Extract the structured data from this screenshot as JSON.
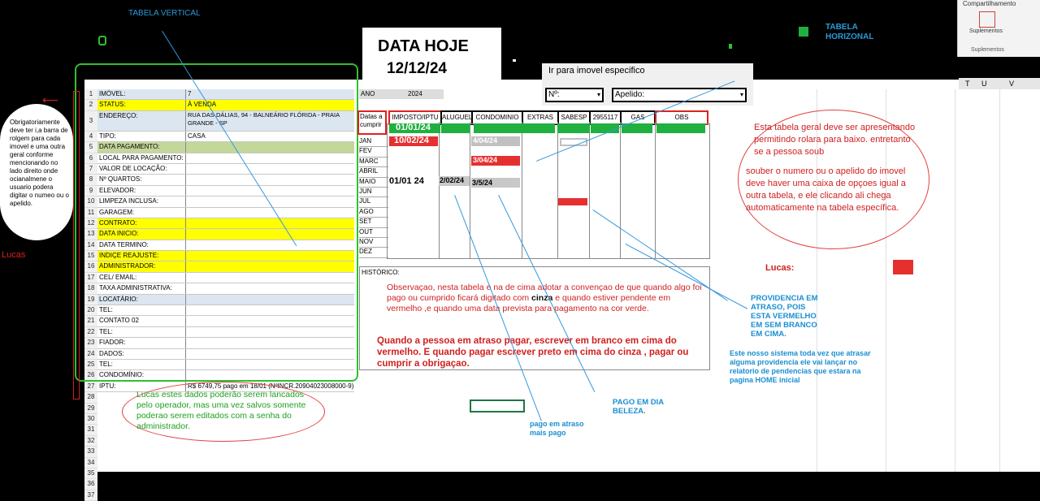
{
  "labels": {
    "tabela_vertical": "TABELA VERTICAL",
    "tabela_horizontal_1": "TABELA",
    "tabela_horizontal_2": "HORIZONAL",
    "data_hoje": "DATA HOJE",
    "data_hoje_value": "12/12/24",
    "ir_para": "Ir para imovel especifico",
    "no_field": "Nº:",
    "apelido_field": "Apelido:",
    "ano_label": "ANO",
    "ano_value": "2024",
    "datas_a_cumprir": "Datas a cumprir",
    "historico": "HISTÓRICO:",
    "lucas_left": "Lucas",
    "lucas_right": "Lucas:"
  },
  "ribbon": {
    "title": "Compartilhamento",
    "suplementos_button": "Suplementos",
    "suplementos_group": "Suplementos",
    "columns": [
      "T",
      "U",
      "V"
    ]
  },
  "vertical_table": [
    {
      "n": "1",
      "label": "IMÓVEL:",
      "value": "7",
      "style": "blue"
    },
    {
      "n": "2",
      "label": "STATUS:",
      "value": "À VENDA",
      "style": "yellow"
    },
    {
      "n": "3",
      "label": "ENDEREÇO:",
      "value": "RUA DAS DÁLIAS, 94 - BALNEÁRIO FLÓRIDA - PRAIA GRANDE - SP",
      "style": "blue",
      "tall": true
    },
    {
      "n": "4",
      "label": "TIPO:",
      "value": "CASA",
      "style": ""
    },
    {
      "n": "5",
      "label": "DATA PAGAMENTO:",
      "value": "",
      "style": "green"
    },
    {
      "n": "6",
      "label": "LOCAL PARA PAGAMENTO:",
      "value": "",
      "style": ""
    },
    {
      "n": "7",
      "label": "VALOR DE LOCAÇÃO:",
      "value": "",
      "style": ""
    },
    {
      "n": "8",
      "label": "Nº QUARTOS:",
      "value": "",
      "style": ""
    },
    {
      "n": "9",
      "label": "ELEVADOR:",
      "value": "",
      "style": ""
    },
    {
      "n": "10",
      "label": "LIMPEZA INCLUSA:",
      "value": "",
      "style": ""
    },
    {
      "n": "11",
      "label": "GARAGEM:",
      "value": "",
      "style": ""
    },
    {
      "n": "12",
      "label": "CONTRATO:",
      "value": "",
      "style": "yellow"
    },
    {
      "n": "13",
      "label": "DATA INICIO:",
      "value": "",
      "style": "yellow"
    },
    {
      "n": "14",
      "label": "DATA TERMINO:",
      "value": "",
      "style": ""
    },
    {
      "n": "15",
      "label": "INDIÇE REAJUSTE:",
      "value": "",
      "style": "yellow"
    },
    {
      "n": "16",
      "label": "ADMINISTRADOR:",
      "value": "",
      "style": "yellow"
    },
    {
      "n": "17",
      "label": "CEL/ EMAIL:",
      "value": "",
      "style": ""
    },
    {
      "n": "18",
      "label": "TAXA ADMINISTRATIVA:",
      "value": "",
      "style": ""
    },
    {
      "n": "19",
      "label": "LOCATÁRIO:",
      "value": "",
      "style": "blue"
    },
    {
      "n": "20",
      "label": "TEL:",
      "value": "",
      "style": ""
    },
    {
      "n": "21",
      "label": "CONTATO 02",
      "value": "",
      "style": ""
    },
    {
      "n": "22",
      "label": "TEL:",
      "value": "",
      "style": ""
    },
    {
      "n": "23",
      "label": "FIADOR:",
      "value": "",
      "style": ""
    },
    {
      "n": "24",
      "label": "DADOS:",
      "value": "",
      "style": ""
    },
    {
      "n": "25",
      "label": "TEL:",
      "value": "",
      "style": ""
    },
    {
      "n": "26",
      "label": "CONDOMÍNIO:",
      "value": "",
      "style": ""
    },
    {
      "n": "27",
      "label": "IPTU:",
      "value": "R$ 6749,75 pago em 18/01 (NºINCR.20904023008000-9)",
      "style": ""
    }
  ],
  "extra_rows": [
    "28",
    "29",
    "30",
    "31",
    "32",
    "33",
    "34",
    "35",
    "36",
    "37"
  ],
  "horizontal_headers": [
    "IMPOSTO/IPTU",
    "ALUGUEL",
    "CONDOMINIO",
    "EXTRAS",
    "SABESP",
    "2955117",
    "GAS",
    "OBS"
  ],
  "months": [
    "JAN",
    "FEV",
    "MARC",
    "ABRIL",
    "MAIO",
    "JUN",
    "JUL",
    "AGO",
    "SET",
    "OUT",
    "NOV",
    "DEZ"
  ],
  "cells": {
    "due_date": "01/01/24",
    "jan_imposto": "10/02/24",
    "jan_condominio": "4/04/24",
    "marc_condominio": "3/04/24",
    "maio_imposto": "01/01 24",
    "maio_aluguel": "2/02/24",
    "maio_condominio": "3/5/24"
  },
  "notes": {
    "left_bubble": "Obrigatoriamente deve ter i,a barra de rolgem para cada imovel e uma outra geral conforme mencionando no lado direito onde ocianalmene o usuario podera digitar o numeo ou o apelido.",
    "right_bubble_1": "Esta tabela geral deve ser apresentando permitindo rolara para baixo. entretanto se a pessoa soub",
    "right_bubble_2": "souber o numero ou o apelido do imovel deve haver uma caixa de opçoes igual a outra tabela, e ele clicando ali chega automaticamente na tabela específica.",
    "obs_1_a": "Observaçao, nesta tabela e na de cima adotar a convençao de que quando algo foi pago ou cumprido ficará digitado com",
    "obs_1_cinza": "cinza",
    "obs_1_b": "e quando estiver pendente em vermelho ,e quando uma data prevista para pagamento na cor verde.",
    "obs_2": "Quando a pessoa em atraso pagar, escrever em branco em cima do vermelho. E quando pagar escrever preto em cima do cinza , pagar ou cumprir a obrigaçao.",
    "bottom_bubble": "Lucas estes dados poderão serem lancados pelo operador, mas uma vez salvos somente poderao serem editados com a senha do administrador.",
    "providencia": "PROVIDENCIA EM ATRASO, POIS ESTA VERMELHO EM SEM BRANCO EM CIMA.",
    "sistema": "Este nosso sistema toda vez que atrasar alguma providencia ele vai lançar no relatorio de pendencias que estara na pagina    HOME inicial",
    "pago_em_dia": "PAGO EM DIA BELEZA.",
    "pago_atraso": "pago em atraso mais pago"
  }
}
